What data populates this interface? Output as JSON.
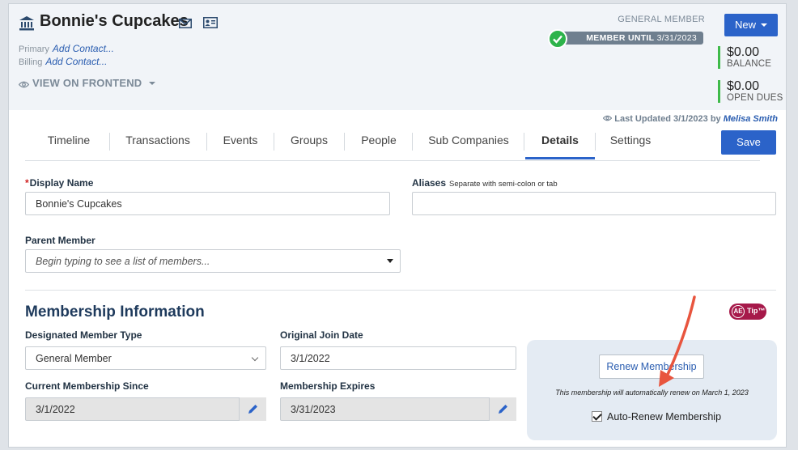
{
  "header": {
    "org_name": "Bonnie's Cupcakes",
    "primary_label": "Primary",
    "primary_link": "Add Contact...",
    "billing_label": "Billing",
    "billing_link": "Add Contact...",
    "frontend_link": "VIEW ON FRONTEND",
    "member_tier": "GENERAL MEMBER",
    "member_until_label": "MEMBER UNTIL",
    "member_until_date": "3/31/2023",
    "new_button": "New",
    "balance_amount": "$0.00",
    "balance_label": "BALANCE",
    "dues_amount": "$0.00",
    "dues_label": "OPEN DUES"
  },
  "last_updated": {
    "text": "Last Updated 3/1/2023 by",
    "user": "Melisa Smith"
  },
  "tabs": [
    {
      "label": "Timeline"
    },
    {
      "label": "Transactions"
    },
    {
      "label": "Events"
    },
    {
      "label": "Groups"
    },
    {
      "label": "People"
    },
    {
      "label": "Sub Companies"
    },
    {
      "label": "Details",
      "active": true
    },
    {
      "label": "Settings"
    }
  ],
  "save_button": "Save",
  "form": {
    "display_name_label": "Display Name",
    "display_name_required": "*",
    "display_name_value": "Bonnie's Cupcakes",
    "aliases_label": "Aliases",
    "aliases_hint": "Separate with semi-colon or tab",
    "aliases_value": "",
    "parent_label": "Parent Member",
    "parent_placeholder": "Begin typing to see a list of members..."
  },
  "membership": {
    "section_title": "Membership Information",
    "tip_ae": "AE",
    "tip_label": "Tip™",
    "member_type_label": "Designated Member Type",
    "member_type_value": "General Member",
    "join_date_label": "Original Join Date",
    "join_date_value": "3/1/2022",
    "current_since_label": "Current Membership Since",
    "current_since_value": "3/1/2022",
    "expires_label": "Membership Expires",
    "expires_value": "3/31/2023",
    "renew_button": "Renew Membership",
    "renew_note": "This membership will automatically renew on March 1, 2023",
    "auto_renew_label": "Auto-Renew Membership",
    "auto_renew_checked": true
  },
  "colors": {
    "accent": "#2b63c9",
    "success": "#2db34a",
    "tip_badge": "#a6194a",
    "annotation_arrow": "#e8553e"
  }
}
